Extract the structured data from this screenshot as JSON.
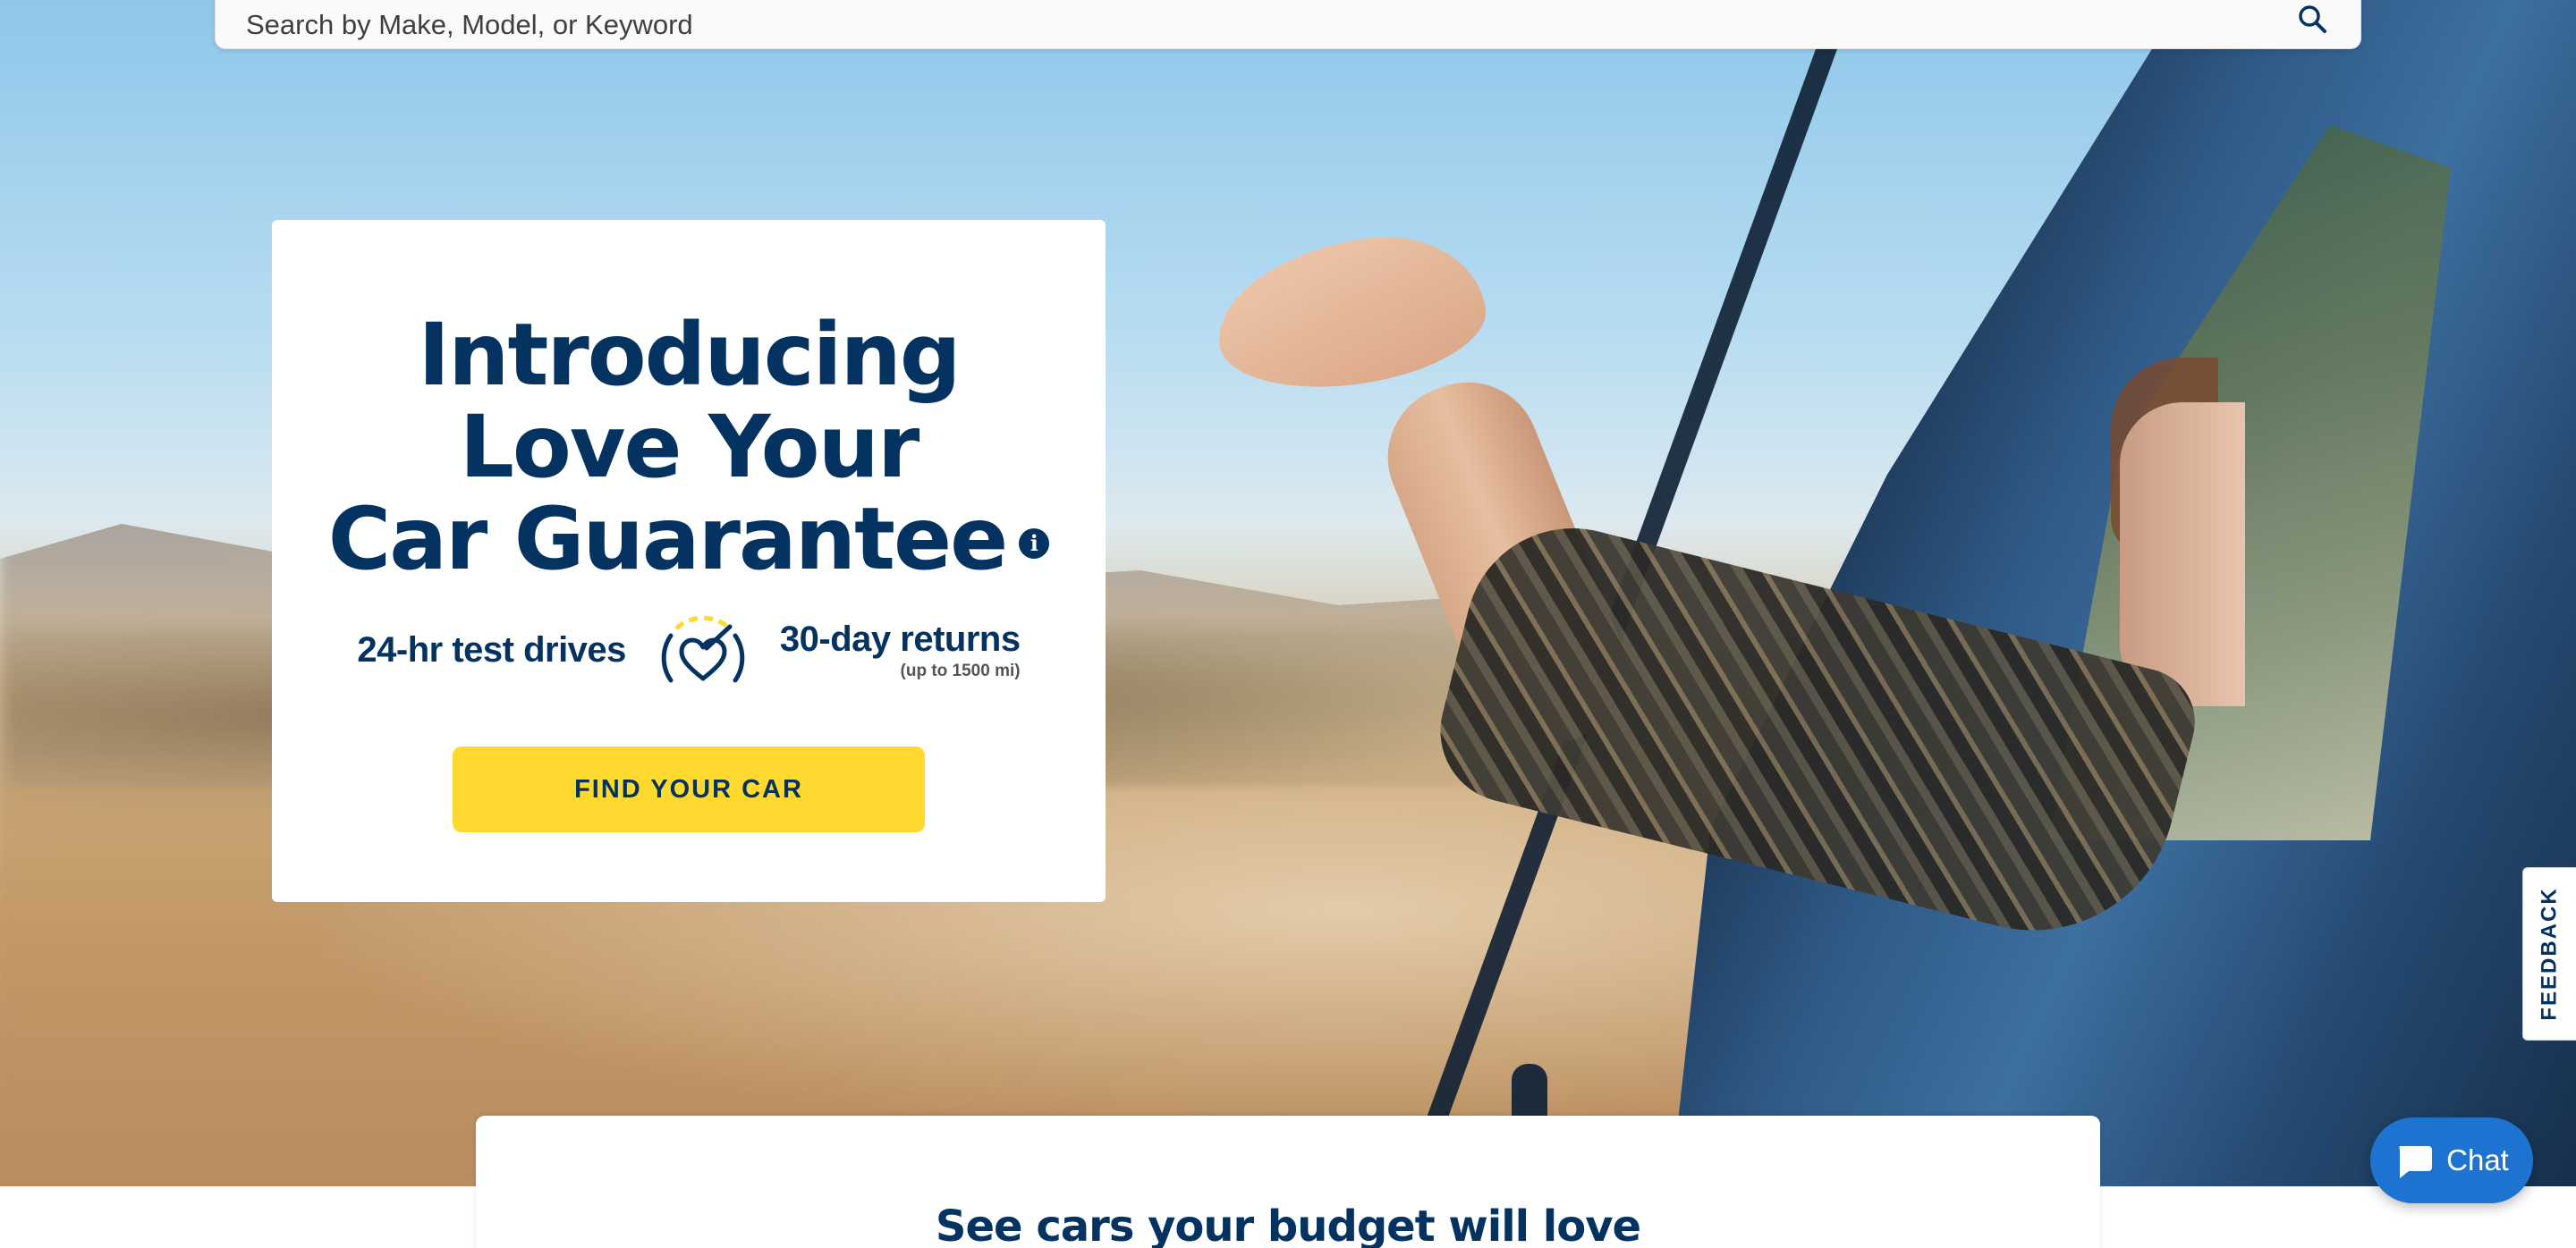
{
  "search": {
    "placeholder": "Search by Make, Model, or Keyword",
    "icon": "search-icon"
  },
  "promo": {
    "headline": [
      "Introducing",
      "Love Your",
      "Car Guarantee"
    ],
    "info_icon": "info-icon",
    "feature_left": "24-hr test drives",
    "feature_right": "30-day returns",
    "feature_right_note": "(up to 1500 mi)",
    "guarantee_icon": "heart-gauge-icon",
    "cta_label": "FIND YOUR CAR"
  },
  "budget": {
    "title": "See cars your budget will love"
  },
  "feedback": {
    "label": "FEEDBACK"
  },
  "chat": {
    "label": "Chat",
    "icon": "chat-bubble-icon"
  },
  "colors": {
    "brand_navy": "#053361",
    "cta_yellow": "#ffd92e",
    "chat_blue": "#1f73d0"
  }
}
